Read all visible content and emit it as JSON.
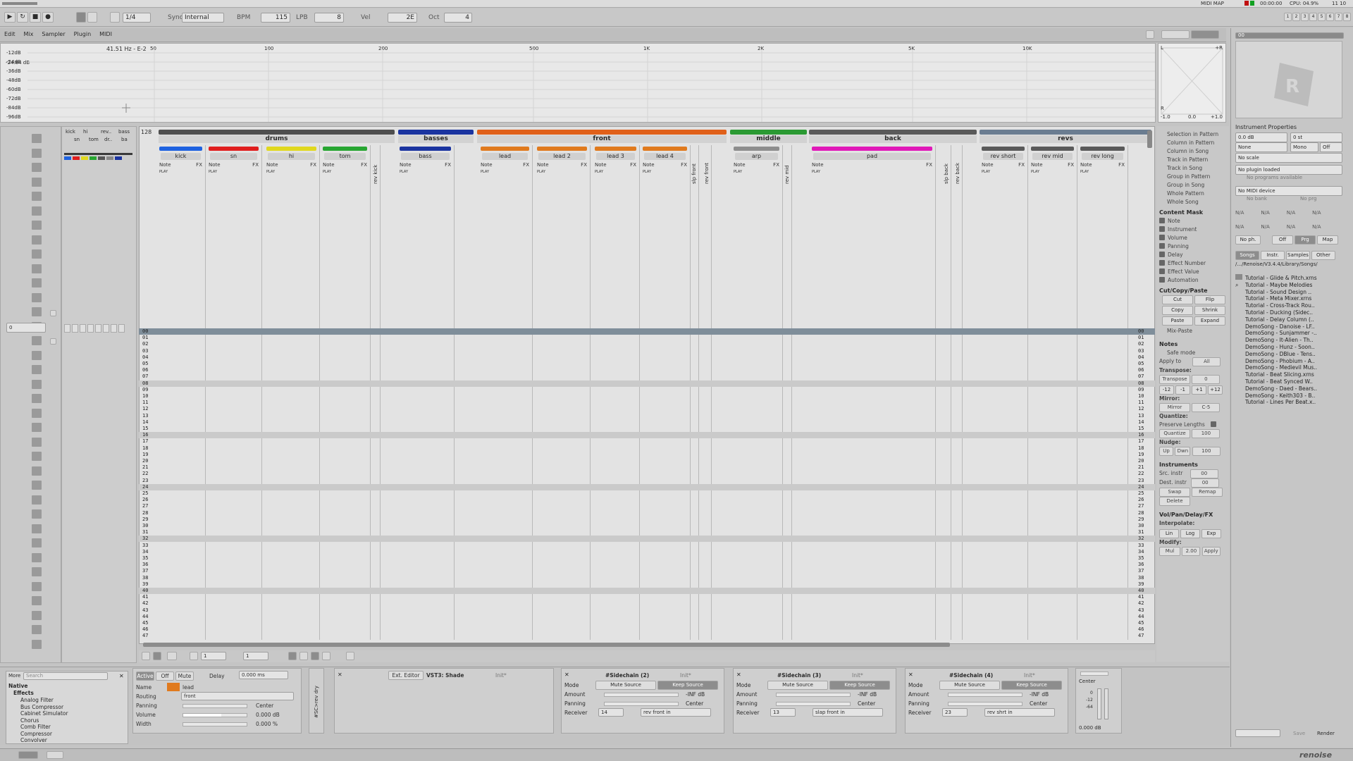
{
  "transport": {
    "position": "1/4",
    "sync_label": "Sync",
    "sync_value": "Internal",
    "bpm_label": "BPM",
    "bpm_value": "115",
    "lpb_label": "LPB",
    "lpb_value": "8",
    "vel_label": "Vel",
    "vel_value": "2E",
    "oct_label": "Oct",
    "oct_value": "4",
    "time": "00:00:00",
    "cpu": "CPU: 04.9%",
    "cpu_value": "11 10",
    "midi_map": "MIDI MAP",
    "pattern_slots": [
      "1",
      "2",
      "3",
      "4",
      "5",
      "6",
      "7",
      "8"
    ]
  },
  "tabs": [
    "Edit",
    "Mix",
    "Sampler",
    "Plugin",
    "MIDI"
  ],
  "spectrum": {
    "readout": "41.51 Hz - E-2",
    "db_labels": [
      "-12dB",
      "-24dB",
      "-36dB",
      "-48dB",
      "-60dB",
      "-72dB",
      "-84dB",
      "-96dB"
    ],
    "freq_labels": [
      "50",
      "100",
      "200",
      "500",
      "1K",
      "2K",
      "5K",
      "10K"
    ],
    "top_db": "-24.84 dB",
    "scope_left": "L",
    "scope_right": "R",
    "scope_min": "-1.0",
    "scope_mid": "0.0",
    "scope_max": "+1.0",
    "scope_r": "+R"
  },
  "minimap": {
    "tracks": [
      "kick",
      "hi",
      "rev..",
      "bass",
      "sn",
      "tom",
      "dr..",
      "ba"
    ]
  },
  "groups": [
    {
      "name": "drums",
      "color": "#4e4e4e"
    },
    {
      "name": "basses",
      "color": "#1b34a0"
    },
    {
      "name": "front",
      "color": "#e0601a"
    },
    {
      "name": "middle",
      "color": "#2b9a33"
    },
    {
      "name": "back",
      "color": "#5a5a5a"
    },
    {
      "name": "revs",
      "color": "#6b7d91"
    }
  ],
  "tracks": [
    {
      "name": "kick",
      "color": "#1e62e0"
    },
    {
      "name": "sn",
      "color": "#e01e1e"
    },
    {
      "name": "hi",
      "color": "#e0d81e"
    },
    {
      "name": "tom",
      "color": "#28a632"
    },
    {
      "name": "bass",
      "color": "#1b34a0"
    },
    {
      "name": "lead",
      "color": "#e07a1e"
    },
    {
      "name": "lead 2",
      "color": "#e07a1e"
    },
    {
      "name": "lead 3",
      "color": "#e07a1e"
    },
    {
      "name": "lead 4",
      "color": "#e07a1e"
    },
    {
      "name": "arp",
      "color": "#8d8d8d"
    },
    {
      "name": "pad",
      "color": "#e019b8"
    },
    {
      "name": "rev short",
      "color": "#5a5a5a"
    },
    {
      "name": "rev mid",
      "color": "#5a5a5a"
    },
    {
      "name": "rev long",
      "color": "#5a5a5a"
    }
  ],
  "send_tracks": [
    "rev kick",
    "slp front",
    "rev front",
    "rev mid",
    "slp back",
    "rev back"
  ],
  "track_cols": {
    "note": "Note",
    "fx": "FX",
    "play": "PLAY"
  },
  "pattern_length": "128",
  "rows": [
    "00",
    "01",
    "02",
    "03",
    "04",
    "05",
    "06",
    "07",
    "08",
    "09",
    "10",
    "11",
    "12",
    "13",
    "14",
    "15",
    "16",
    "17",
    "18",
    "19",
    "20",
    "21",
    "22",
    "23",
    "24",
    "25",
    "26",
    "27",
    "28",
    "29",
    "30",
    "31",
    "32",
    "33",
    "34",
    "35",
    "36",
    "37",
    "38",
    "39",
    "40",
    "41",
    "42",
    "43",
    "44",
    "45",
    "46",
    "47"
  ],
  "options": {
    "scope": [
      "Selection in Pattern",
      "Column in Pattern",
      "Column in Song",
      "Track in Pattern",
      "Track in Song",
      "Group in Pattern",
      "Group in Song",
      "Whole Pattern",
      "Whole Song"
    ],
    "content_mask_title": "Content Mask",
    "content_mask": [
      "Note",
      "Instrument",
      "Volume",
      "Panning",
      "Delay",
      "Effect Number",
      "Effect Value",
      "Automation"
    ],
    "cut_title": "Cut/Copy/Paste",
    "cut_buttons": [
      "Cut",
      "Flip",
      "Copy",
      "Shrink",
      "Paste",
      "Expand"
    ],
    "mix_paste": "Mix-Paste",
    "notes_title": "Notes",
    "safe_mode": "Safe mode",
    "apply_to": "Apply to",
    "apply_value": "All",
    "transpose_title": "Transpose:",
    "transpose_label": "Transpose",
    "transpose_value": "0",
    "transpose_buttons": [
      "-12",
      "-1",
      "+1",
      "+12"
    ],
    "mirror_title": "Mirror:",
    "mirror_label": "Mirror",
    "mirror_value": "C-5",
    "quantize_title": "Quantize:",
    "preserve": "Preserve Lengths",
    "quantize_label": "Quantize",
    "quantize_value": "100",
    "nudge_title": "Nudge:",
    "nudge_up": "Up",
    "nudge_down": "Dwn",
    "nudge_value": "100",
    "instruments_title": "Instruments",
    "src_instr": "Src. instr",
    "src_value": "00",
    "dest_instr": "Dest. instr",
    "dest_value": "00",
    "swap": "Swap",
    "remap": "Remap",
    "delete": "Delete",
    "vol_title": "Vol/Pan/Delay/FX",
    "interpolate": "Interpolate:",
    "interp_buttons": [
      "Lin",
      "Log",
      "Exp"
    ],
    "modify": "Modify:",
    "modify_mode": "Mul",
    "modify_value": "2.00",
    "apply": "Apply"
  },
  "instrument": {
    "slot": "00",
    "title": "Instrument Properties",
    "volume": "0.0 dB",
    "transpose": "0 st",
    "none": "None",
    "mono": "Mono",
    "off": "Off",
    "scale": "No scale",
    "plugin": "No plugin loaded",
    "programs": "No programs available",
    "midi": "No MIDI device",
    "bank": "No bank",
    "prg": "No prg",
    "na": "N/A",
    "no_ph": "No ph.",
    "off_btn": "Off",
    "prg_btn": "Prg",
    "map": "Map"
  },
  "browser": {
    "tabs": [
      "Songs",
      "Instr.",
      "Samples",
      "Other"
    ],
    "path": "/.../Renoise/V3.4.4/Library/Songs/",
    "files": [
      "Tutorial - Glide & Pitch.xrns",
      "Tutorial - Maybe Melodies",
      "Tutorial - Sound Design ..",
      "Tutorial - Meta Mixer.xrns",
      "Tutorial - Cross-Track Rou..",
      "Tutorial - Ducking (Sidec..",
      "Tutorial - Delay Column (..",
      "DemoSong - Danoise - LF..",
      "DemoSong - Sunjammer -..",
      "DemoSong - It-Alien - Th..",
      "DemoSong - Hunz - Soon..",
      "DemoSong - DBlue - Tens..",
      "DemoSong - Phobium - A..",
      "DemoSong - Medievil Mus..",
      "Tutorial - Beat Slicing.xrns",
      "Tutorial - Beat Synced W..",
      "DemoSong - Daed - Bears..",
      "DemoSong - Keith303 - B..",
      "Tutorial - Lines Per Beat.x.."
    ],
    "save": "Save",
    "render": "Render"
  },
  "effects": {
    "more": "More",
    "search": "Search",
    "native": "Native",
    "effects": "Effects",
    "items": [
      "Analog Filter",
      "Bus Compressor",
      "Cabinet Simulator",
      "Chorus",
      "Comb Filter",
      "Compressor",
      "Convolver"
    ]
  },
  "track_dsp": {
    "active": "Active",
    "off": "Off",
    "mute": "Mute",
    "delay": "Delay",
    "delay_value": "0.000 ms",
    "name_label": "Name",
    "name": "lead",
    "routing_label": "Routing",
    "routing": "front",
    "panning_label": "Panning",
    "center": "Center",
    "volume_label": "Volume",
    "volume_value": "0.000 dB",
    "width_label": "Width",
    "width_value": "0.000 %",
    "dry": "#SC>rev dry"
  },
  "vst": {
    "ext_editor": "Ext. Editor",
    "name": "VST3: Shade",
    "preset": "Init*"
  },
  "sidechains": [
    {
      "name": "#Sidechain (2)",
      "init": "Init*",
      "mode": "Mode",
      "mute_source": "Mute Source",
      "keep_source": "Keep Source",
      "amount": "Amount",
      "inf": "-INF dB",
      "panning": "Panning",
      "center": "Center",
      "receiver": "Receiver",
      "rcv_num": "14",
      "rcv_name": "rev front in"
    },
    {
      "name": "#Sidechain (3)",
      "init": "Init*",
      "mode": "Mode",
      "mute_source": "Mute Source",
      "keep_source": "Keep Source",
      "amount": "Amount",
      "inf": "-INF dB",
      "panning": "Panning",
      "center": "Center",
      "receiver": "Receiver",
      "rcv_num": "13",
      "rcv_name": "slap front in"
    },
    {
      "name": "#Sidechain (4)",
      "init": "Init*",
      "mode": "Mode",
      "mute_source": "Mute Source",
      "keep_source": "Keep Source",
      "amount": "Amount",
      "inf": "-INF dB",
      "panning": "Panning",
      "center": "Center",
      "receiver": "Receiver",
      "rcv_num": "23",
      "rcv_name": "rev shrt in"
    }
  ],
  "master": {
    "center": "Center",
    "db": "0.000 dB",
    "scale": [
      "0",
      "-12",
      "-64"
    ]
  },
  "edit_step": {
    "step": "1",
    "pattern": "1"
  },
  "brand": "renoise"
}
